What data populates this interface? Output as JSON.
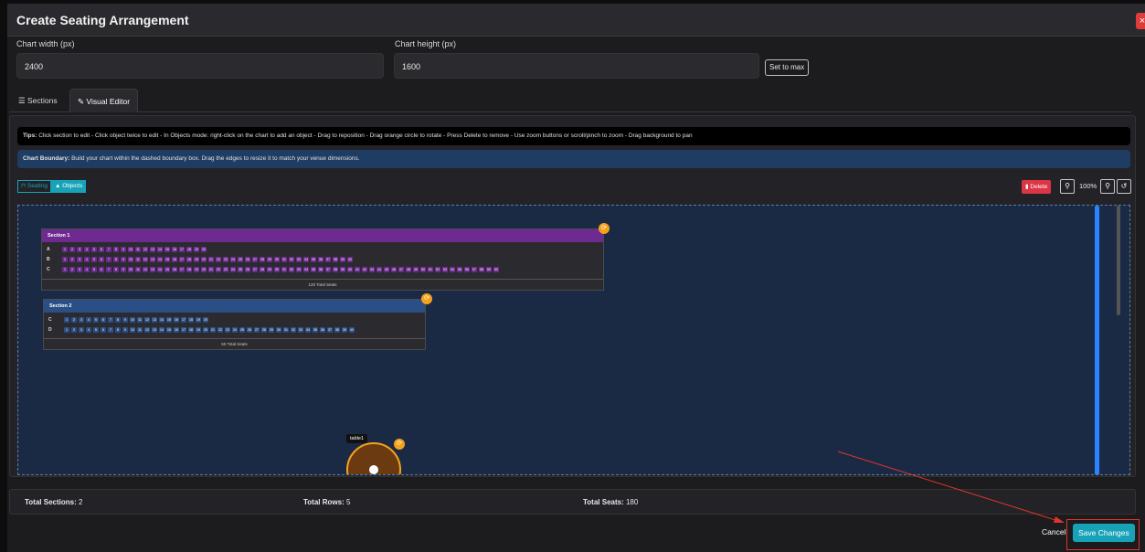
{
  "header": {
    "title": "Create Seating Arrangement",
    "close_icon": "×"
  },
  "form": {
    "width_label": "Chart width (px)",
    "width_value": "2400",
    "height_label": "Chart height (px)",
    "height_value": "1600",
    "set_max_label": "Set to max"
  },
  "tabs": [
    {
      "label": "Sections",
      "icon": "list-icon"
    },
    {
      "label": "Visual Editor",
      "icon": "brush-icon",
      "active": true
    }
  ],
  "editor": {
    "tips_bold": "Tips:",
    "tips_text": "Click section to edit - Click object twice to edit - In Objects mode: right-click on the chart to add an object - Drag to reposition - Drag orange circle to rotate - Press Delete to remove - Use zoom buttons or scroll/pinch to zoom - Drag background to pan",
    "boundary_bold": "Chart Boundary:",
    "boundary_text": "Build your chart within the dashed boundary box. Drag the edges to resize it to match your venue dimensions.",
    "mode_seating": "Seating",
    "mode_objects": "Objects",
    "delete_label": "Delete",
    "zoom_level": "100%"
  },
  "sections": [
    {
      "name": "Section 1",
      "color": "#6f2a92",
      "rows": [
        {
          "label": "A",
          "count": 20
        },
        {
          "label": "B",
          "count": 40
        },
        {
          "label": "C",
          "count": 60
        }
      ],
      "total": "120 Total Seats"
    },
    {
      "name": "Section 2",
      "color": "#2a4f86",
      "rows": [
        {
          "label": "C",
          "count": 20
        },
        {
          "label": "D",
          "count": 40
        }
      ],
      "total": "60 Total Seats"
    }
  ],
  "table_object": {
    "label": "table1"
  },
  "stats": {
    "sections_label": "Total Sections:",
    "sections_value": "2",
    "rows_label": "Total Rows:",
    "rows_value": "5",
    "seats_label": "Total Seats:",
    "seats_value": "180"
  },
  "footer": {
    "cancel_label": "Cancel",
    "save_label": "Save Changes"
  },
  "colors": {
    "accent": "#17a2b8",
    "danger": "#dc3545",
    "handle": "#f5a21b"
  }
}
